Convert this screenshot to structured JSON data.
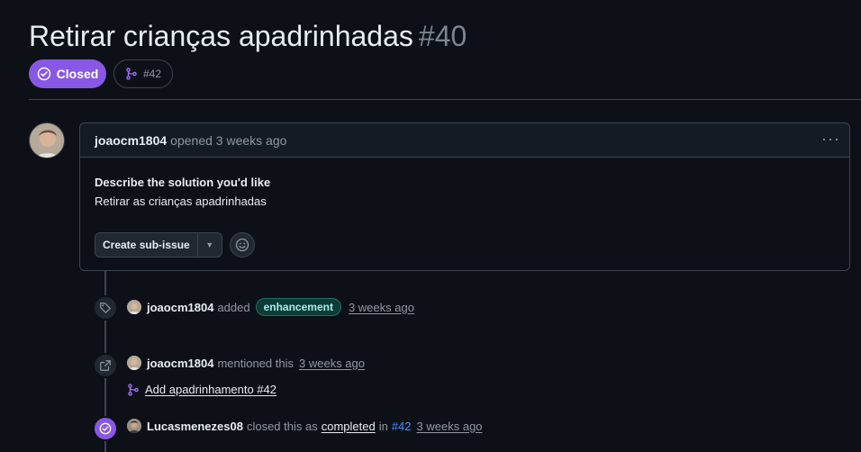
{
  "issue": {
    "title": "Retirar crianças apadrinhadas",
    "number": "#40",
    "state": "Closed",
    "linked_pr": "#42"
  },
  "comment": {
    "author": "joaocm1804",
    "action": "opened",
    "time": "3 weeks ago",
    "heading": "Describe the solution you'd like",
    "body": "Retirar as crianças apadrinhadas",
    "create_sub_issue": "Create sub-issue"
  },
  "timeline": [
    {
      "author": "joaocm1804",
      "verb": "added",
      "label": "enhancement",
      "time": "3 weeks ago"
    },
    {
      "author": "joaocm1804",
      "verb": "mentioned this",
      "time": "3 weeks ago",
      "ref_title": "Add apadrinhamento",
      "ref_number": "#42"
    },
    {
      "author": "Lucasmenezes08",
      "verb": "closed this as",
      "reason": "completed",
      "in_word": "in",
      "ref": "#42",
      "time": "3 weeks ago"
    }
  ],
  "colors": {
    "closed": "#8957e5",
    "label_bg": "#0d3b36",
    "label_text": "#a2eeef",
    "link_blue": "#4493f8"
  }
}
